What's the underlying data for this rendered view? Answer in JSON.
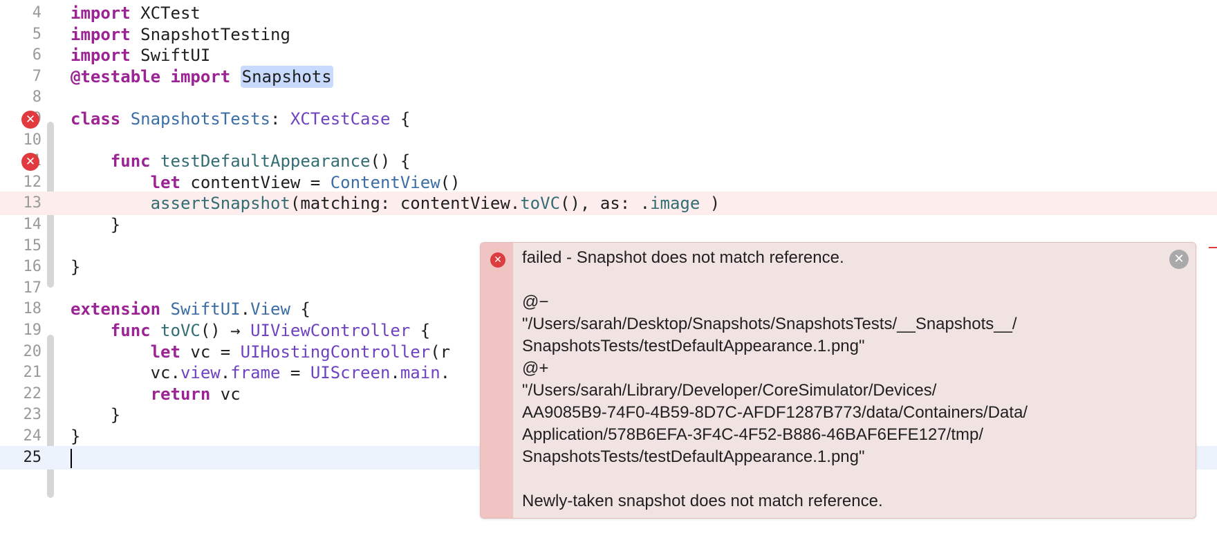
{
  "editor": {
    "lines": [
      {
        "num": "4",
        "tokens": [
          [
            "kw",
            "import"
          ],
          [
            "",
            "XCTest"
          ]
        ]
      },
      {
        "num": "5",
        "tokens": [
          [
            "kw",
            "import"
          ],
          [
            "",
            "SnapshotTesting"
          ]
        ]
      },
      {
        "num": "6",
        "tokens": [
          [
            "kw",
            "import"
          ],
          [
            "",
            "SwiftUI"
          ]
        ]
      },
      {
        "num": "7",
        "tokens": [
          [
            "attr",
            "@testable"
          ],
          [
            "kw",
            "import"
          ],
          [
            "hl",
            "Snapshots"
          ]
        ]
      },
      {
        "num": "8",
        "tokens": []
      },
      {
        "num": "9",
        "error_marker": true,
        "tokens": [
          [
            "kw",
            "class"
          ],
          [
            "typ",
            "SnapshotsTests"
          ],
          [
            "",
            ":"
          ],
          [
            "sys",
            "XCTestCase"
          ],
          [
            "",
            "{"
          ]
        ]
      },
      {
        "num": "10",
        "tokens": []
      },
      {
        "num": "11",
        "error_marker": true,
        "tokens": [
          [
            "",
            "    "
          ],
          [
            "kw",
            "func"
          ],
          [
            "fn",
            "testDefaultAppearance"
          ],
          [
            "",
            "() {"
          ]
        ]
      },
      {
        "num": "12",
        "tokens": [
          [
            "",
            "        "
          ],
          [
            "kw",
            "let"
          ],
          [
            "",
            "contentView ="
          ],
          [
            "typ",
            "ContentView"
          ],
          [
            "",
            "()"
          ]
        ]
      },
      {
        "num": "13",
        "state": "error",
        "tokens": [
          [
            "",
            "        "
          ],
          [
            "fn",
            "assertSnapshot"
          ],
          [
            "",
            "(matching: contentView."
          ],
          [
            "fn",
            "toVC"
          ],
          [
            "",
            "(), as: ."
          ],
          [
            "fn",
            "image"
          ],
          [
            "",
            ")"
          ]
        ]
      },
      {
        "num": "14",
        "tokens": [
          [
            "",
            "    }"
          ]
        ]
      },
      {
        "num": "15",
        "tokens": []
      },
      {
        "num": "16",
        "tokens": [
          [
            "",
            "}"
          ]
        ]
      },
      {
        "num": "17",
        "tokens": []
      },
      {
        "num": "18",
        "tokens": [
          [
            "kw",
            "extension"
          ],
          [
            "typ",
            "SwiftUI"
          ],
          [
            "",
            "."
          ],
          [
            "typ",
            "View"
          ],
          [
            "",
            "{"
          ]
        ]
      },
      {
        "num": "19",
        "tokens": [
          [
            "",
            "    "
          ],
          [
            "kw",
            "func"
          ],
          [
            "fn",
            "toVC"
          ],
          [
            "",
            "() → "
          ],
          [
            "sys",
            "UIViewController"
          ],
          [
            "",
            "{"
          ]
        ]
      },
      {
        "num": "20",
        "tokens": [
          [
            "",
            "        "
          ],
          [
            "kw",
            "let"
          ],
          [
            "",
            "vc ="
          ],
          [
            "sys",
            "UIHostingController"
          ],
          [
            "",
            "(r"
          ]
        ]
      },
      {
        "num": "21",
        "tokens": [
          [
            "",
            "        vc."
          ],
          [
            "sys",
            "view"
          ],
          [
            "",
            "."
          ],
          [
            "sys",
            "frame"
          ],
          [
            "",
            "="
          ],
          [
            "sys",
            "UIScreen"
          ],
          [
            "",
            "."
          ],
          [
            "sys",
            "main"
          ],
          [
            "",
            "."
          ]
        ]
      },
      {
        "num": "22",
        "tokens": [
          [
            "",
            "        "
          ],
          [
            "kw",
            "return"
          ],
          [
            "",
            "vc"
          ]
        ]
      },
      {
        "num": "23",
        "tokens": [
          [
            "",
            "    }"
          ]
        ]
      },
      {
        "num": "24",
        "tokens": [
          [
            "",
            "}"
          ]
        ]
      },
      {
        "num": "25",
        "state": "current",
        "tokens": []
      }
    ],
    "error_marker_glyph": "✕",
    "error_marker_color": "#e0393e"
  },
  "issue_popover": {
    "lines": [
      "failed - Snapshot does not match reference.",
      "",
      "@−",
      "\"/Users/sarah/Desktop/Snapshots/SnapshotsTests/__Snapshots__/",
      "SnapshotsTests/testDefaultAppearance.1.png\"",
      "@+",
      "\"/Users/sarah/Library/Developer/CoreSimulator/Devices/",
      "AA9085B9-74F0-4B59-8D7C-AFDF1287B773/data/Containers/Data/",
      "Application/578B6EFA-3F4C-4F52-B886-46BAF6EFE127/tmp/",
      "SnapshotsTests/testDefaultAppearance.1.png\"",
      "",
      "Newly-taken snapshot does not match reference."
    ],
    "error_icon": "error-icon",
    "close_glyph": "✕",
    "background_color": "#f2e3e3",
    "strip_color": "#f1c4c4"
  }
}
